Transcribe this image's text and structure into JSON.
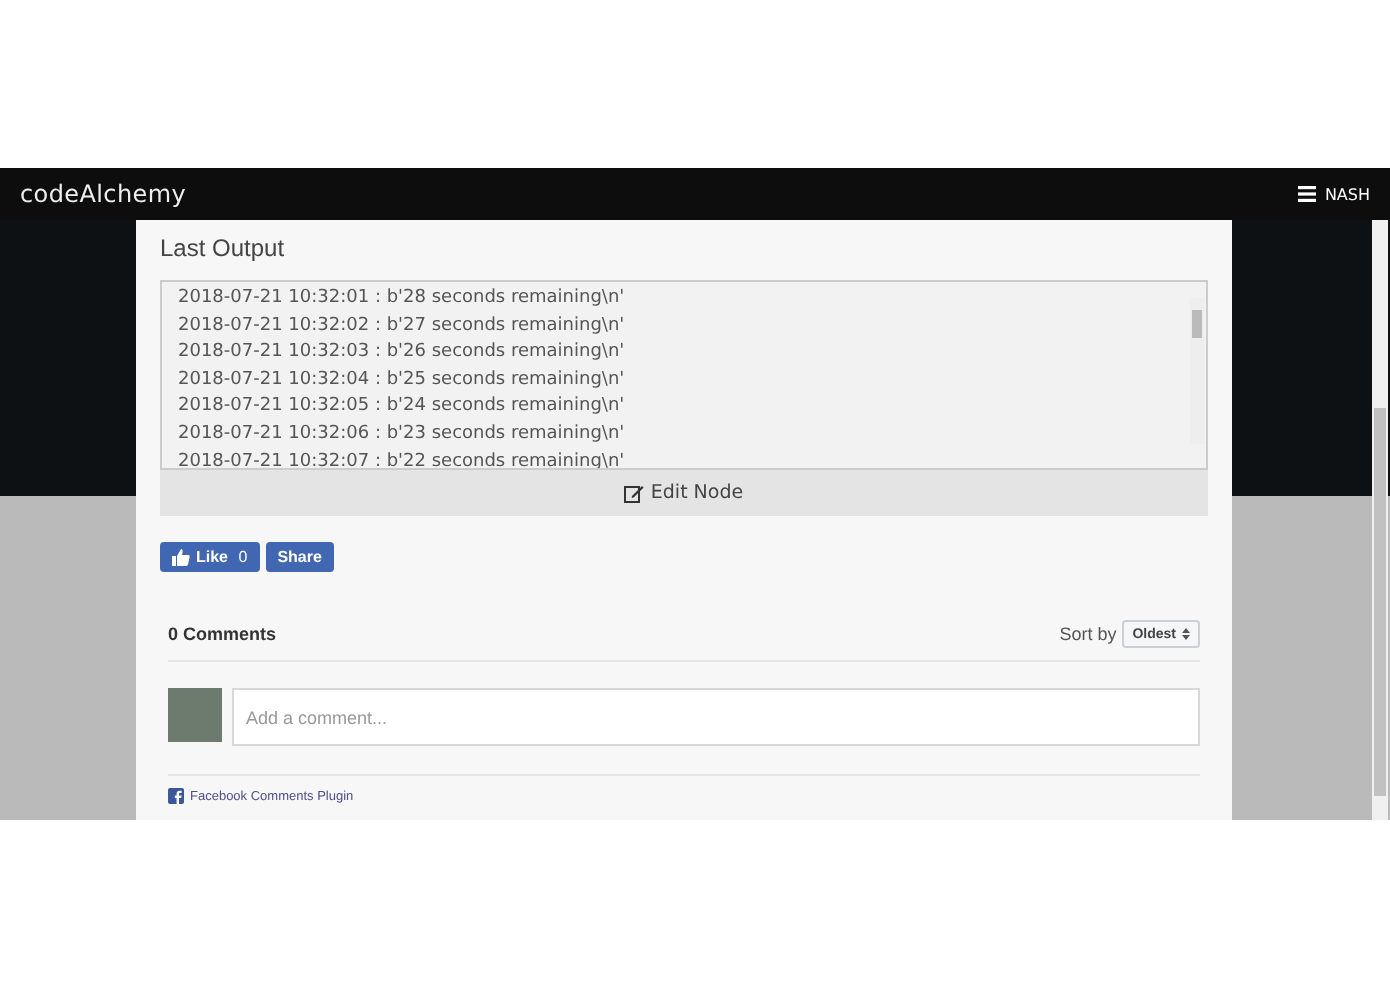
{
  "header": {
    "brand": "codeAlchemy",
    "menu_label": "NASH"
  },
  "card": {
    "title": "Last Output",
    "log_lines": [
      "2018-07-21 10:32:01 : b'28 seconds remaining\\n'",
      "2018-07-21 10:32:02 : b'27 seconds remaining\\n'",
      "2018-07-21 10:32:03 : b'26 seconds remaining\\n'",
      "2018-07-21 10:32:04 : b'25 seconds remaining\\n'",
      "2018-07-21 10:32:05 : b'24 seconds remaining\\n'",
      "2018-07-21 10:32:06 : b'23 seconds remaining\\n'",
      "2018-07-21 10:32:07 : b'22 seconds remaining\\n'"
    ],
    "edit_button": "Edit Node",
    "like_button": {
      "label": "Like",
      "count": "0"
    },
    "share_button": "Share",
    "comments": {
      "count_label": "0 Comments",
      "sort_label": "Sort by",
      "sort_value": "Oldest",
      "placeholder": "Add a comment...",
      "plugin_link": "Facebook Comments Plugin"
    }
  }
}
